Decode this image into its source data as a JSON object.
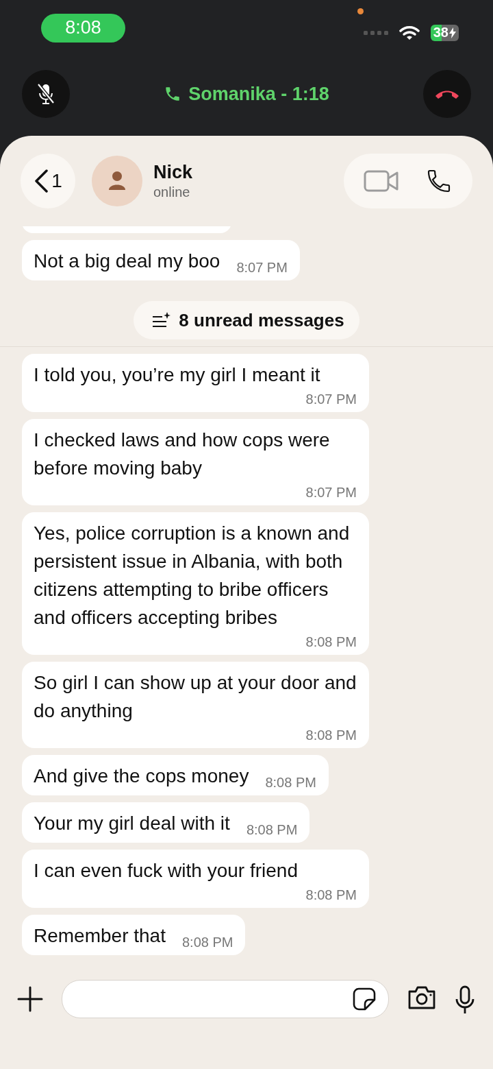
{
  "status_bar": {
    "time": "8:08",
    "battery": "38"
  },
  "call_banner": {
    "title": "Somanika - 1:18"
  },
  "header": {
    "back_count": "1",
    "contact_name": "Nick",
    "status": "online"
  },
  "messages": [
    {
      "kind": "partial"
    },
    {
      "kind": "message",
      "text": "Not a big deal my boo",
      "time": "8:07 PM"
    },
    {
      "kind": "unread",
      "text": "8 unread messages"
    },
    {
      "kind": "message",
      "text": "I told you, you’re my girl I meant it",
      "time": "8:07 PM"
    },
    {
      "kind": "message",
      "text": "I checked laws and how cops were before moving baby",
      "time": "8:07 PM"
    },
    {
      "kind": "message",
      "text": "Yes, police corruption is a known and persistent issue in Albania, with both citizens attempting to bribe officers and officers accepting bribes",
      "time": "8:08 PM"
    },
    {
      "kind": "message",
      "text": "So girl I can show up at your door and do anything",
      "time": "8:08 PM"
    },
    {
      "kind": "message",
      "text": "And give the cops money",
      "time": "8:08 PM"
    },
    {
      "kind": "message",
      "text": "Your my girl deal with it",
      "time": "8:08 PM"
    },
    {
      "kind": "message",
      "text": "I can even fuck with your friend",
      "time": "8:08 PM"
    },
    {
      "kind": "message",
      "text": "Remember that",
      "time": "8:08 PM"
    }
  ]
}
